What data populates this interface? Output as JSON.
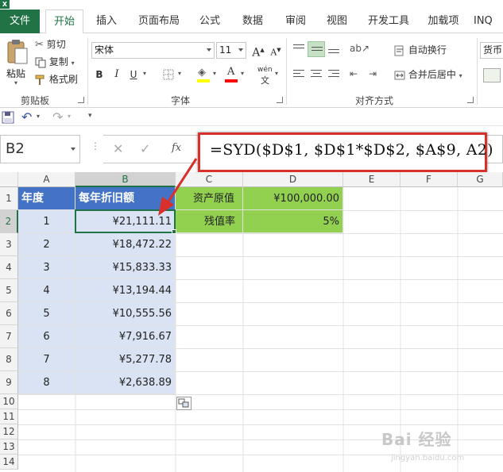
{
  "ribbon": {
    "tabs": [
      "文件",
      "开始",
      "插入",
      "页面布局",
      "公式",
      "数据",
      "审阅",
      "视图",
      "开发工具",
      "加载项",
      "INQ"
    ],
    "active_tab": "开始",
    "clipboard": {
      "paste": "粘贴",
      "cut": "剪切",
      "copy": "复制",
      "format_painter": "格式刷",
      "group_label": "剪贴板"
    },
    "font": {
      "name": "宋体",
      "size": "11",
      "group_label": "字体",
      "bold": "B",
      "italic": "I",
      "underline": "U",
      "grow": "A",
      "shrink": "A",
      "phonetic": "wén"
    },
    "alignment": {
      "wrap_text": "自动换行",
      "merge_center": "合并后居中",
      "group_label": "对齐方式"
    },
    "number": {
      "format": "货币"
    }
  },
  "formula_bar": {
    "name_box": "B2",
    "formula": "=SYD($D$1, $D$1*$D$2, $A$9, A2)",
    "fx": "fx"
  },
  "grid": {
    "columns": [
      "A",
      "B",
      "C",
      "D",
      "E",
      "F",
      "G"
    ],
    "rows": [
      "1",
      "2",
      "3",
      "4",
      "5",
      "6",
      "7",
      "8",
      "9",
      "10",
      "11",
      "12",
      "13",
      "14"
    ],
    "header_a": "年度",
    "header_b": "每年折旧额",
    "years": [
      "1",
      "2",
      "3",
      "4",
      "5",
      "6",
      "7",
      "8"
    ],
    "depreciation": [
      "¥21,111.11",
      "¥18,472.22",
      "¥15,833.33",
      "¥13,194.44",
      "¥10,555.56",
      "¥7,916.67",
      "¥5,277.78",
      "¥2,638.89"
    ],
    "c1": "资产原值",
    "d1": "¥100,000.00",
    "c2": "残值率",
    "d2": "5%"
  },
  "watermark": {
    "text": "Bai 经验",
    "url": "jingyan.baidu.com"
  },
  "colors": {
    "excel_green": "#217346",
    "header_blue": "#4472c4",
    "light_blue": "#dae3f3",
    "green_fill": "#92d050",
    "annotation_red": "#d9302c"
  }
}
